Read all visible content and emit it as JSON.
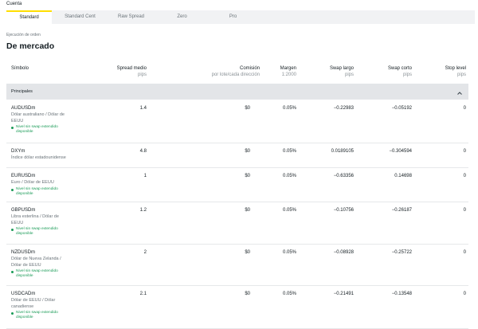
{
  "account_label": "Cuenta",
  "tabs": [
    {
      "label": "Standard",
      "active": true
    },
    {
      "label": "Standard Cent",
      "active": false
    },
    {
      "label": "Raw Spread",
      "active": false
    },
    {
      "label": "Zero",
      "active": false
    },
    {
      "label": "Pro",
      "active": false
    }
  ],
  "execution_label": "Ejecución de orden",
  "execution_type": "De mercado",
  "columns": {
    "symbol": "Símbolo",
    "spread": {
      "label": "Spread medio",
      "unit": "pips"
    },
    "commission": {
      "label": "Comisión",
      "unit": "por lote/cada dirección"
    },
    "margin": {
      "label": "Margen",
      "unit": "1:2000"
    },
    "swap_long": {
      "label": "Swap largo",
      "unit": "pips"
    },
    "swap_short": {
      "label": "Swap corto",
      "unit": "pips"
    },
    "stop_level": {
      "label": "Stop level",
      "unit": "pips"
    }
  },
  "group": {
    "label": "Principales",
    "toggle_icon": "chevron-up-icon",
    "expanded": true
  },
  "colors": {
    "accent": "#ffde02",
    "swap_free": "#1a9b57",
    "group_bg": "#e3e5e8",
    "tabbar_bg": "#f1f2f4"
  },
  "instruments": [
    {
      "symbol": "AUDUSDm",
      "description": [
        "Dólar australiano / Dólar de",
        "EEUU"
      ],
      "swap_free": [
        "Nivel sin swap extendido",
        "disponible"
      ],
      "spread": "1.4",
      "commission": "$0",
      "margin": "0.05%",
      "swap_long": "−0.22983",
      "swap_short": "−0.05192",
      "stop_level": "0"
    },
    {
      "symbol": "DXYm",
      "description": [
        "Índice dólar estadounidense"
      ],
      "swap_free": [],
      "spread": "4.8",
      "commission": "$0",
      "margin": "0.05%",
      "swap_long": "0.0189105",
      "swap_short": "−0.304594",
      "stop_level": "0"
    },
    {
      "symbol": "EURUSDm",
      "description": [
        "Euro / Dólar de EEUU"
      ],
      "swap_free": [
        "Nivel sin swap extendido",
        "disponible"
      ],
      "spread": "1",
      "commission": "$0",
      "margin": "0.05%",
      "swap_long": "−0.63356",
      "swap_short": "0.14698",
      "stop_level": "0"
    },
    {
      "symbol": "GBPUSDm",
      "description": [
        "Libra esterlina / Dólar de",
        "EEUU"
      ],
      "swap_free": [
        "Nivel sin swap extendido",
        "disponible"
      ],
      "spread": "1.2",
      "commission": "$0",
      "margin": "0.05%",
      "swap_long": "−0.10756",
      "swap_short": "−0.26187",
      "stop_level": "0"
    },
    {
      "symbol": "NZDUSDm",
      "description": [
        "Dólar de Nueva Zelanda /",
        "Dólar de EEUU"
      ],
      "swap_free": [
        "Nivel sin swap extendido",
        "disponible"
      ],
      "spread": "2",
      "commission": "$0",
      "margin": "0.05%",
      "swap_long": "−0.08928",
      "swap_short": "−0.25722",
      "stop_level": "0"
    },
    {
      "symbol": "USDCADm",
      "description": [
        "Dólar de EEUU / Dólar",
        "canadiense"
      ],
      "swap_free": [
        "Nivel sin swap extendido",
        "disponible"
      ],
      "spread": "2.1",
      "commission": "$0",
      "margin": "0.05%",
      "swap_long": "−0.21491",
      "swap_short": "−0.13548",
      "stop_level": "0"
    }
  ]
}
